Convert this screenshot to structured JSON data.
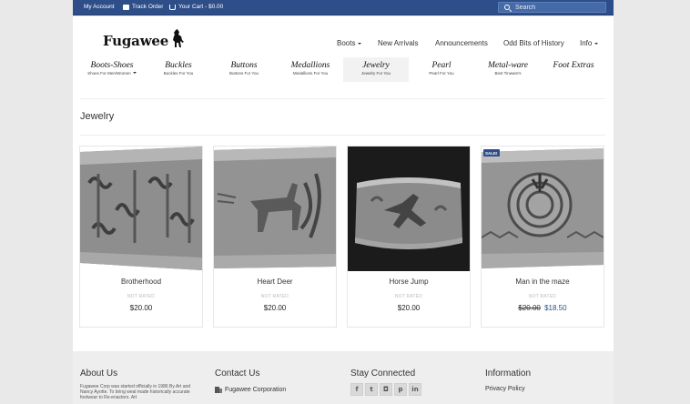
{
  "topbar": {
    "my_account": "My Account",
    "track_order": "Track Order",
    "cart": "Your Cart - $0.00",
    "search_placeholder": "Search"
  },
  "brand": {
    "name": "Fugawee"
  },
  "main_nav": [
    {
      "label": "Boots",
      "dropdown": true
    },
    {
      "label": "New Arrivals",
      "dropdown": false
    },
    {
      "label": "Announcements",
      "dropdown": false
    },
    {
      "label": "Odd Bits of History",
      "dropdown": false
    },
    {
      "label": "Info",
      "dropdown": true
    }
  ],
  "category_nav": [
    {
      "label": "Boots-Shoes",
      "sub": "Shoes For Men/Women",
      "dropdown": true,
      "active": false
    },
    {
      "label": "Buckles",
      "sub": "Buckles For You",
      "active": false
    },
    {
      "label": "Buttons",
      "sub": "Buttons For You",
      "active": false
    },
    {
      "label": "Medallions",
      "sub": "Medallions For You",
      "active": false
    },
    {
      "label": "Jewelry",
      "sub": "Jewelry For You",
      "active": true
    },
    {
      "label": "Pearl",
      "sub": "Pearl For You",
      "active": false
    },
    {
      "label": "Metal-ware",
      "sub": "Best Tinware's",
      "active": false
    },
    {
      "label": "Foot Extras",
      "sub": "",
      "active": false
    }
  ],
  "page_title": "Jewelry",
  "products": [
    {
      "name": "Brotherhood",
      "rating": "NOT RATED",
      "price": "$20.00"
    },
    {
      "name": "Heart Deer",
      "rating": "NOT RATED",
      "price": "$20.00"
    },
    {
      "name": "Horse Jump",
      "rating": "NOT RATED",
      "price": "$20.00"
    },
    {
      "name": "Man in the maze",
      "rating": "NOT RATED",
      "price_old": "$20.00",
      "price": "$18.50",
      "badge": "SALE!"
    }
  ],
  "footer": {
    "about": {
      "title": "About Us",
      "text": "Fugawee Corp was started officially in 1986 By Art and Nancy Ayotte. To bring weal made historically accurate footwear to Re-enactors. Art"
    },
    "contact": {
      "title": "Contact Us",
      "company": "Fugawee Corporation"
    },
    "social": {
      "title": "Stay Connected",
      "icons": [
        "facebook-icon",
        "twitter-icon",
        "instagram-icon",
        "pinterest-icon",
        "linkedin-icon"
      ]
    },
    "info": {
      "title": "Information",
      "link": "Privacy Policy"
    }
  },
  "colors": {
    "brand_blue": "#2e4e8a",
    "sale_price": "#2e4e8a",
    "footer_bg": "#eeeeee"
  }
}
